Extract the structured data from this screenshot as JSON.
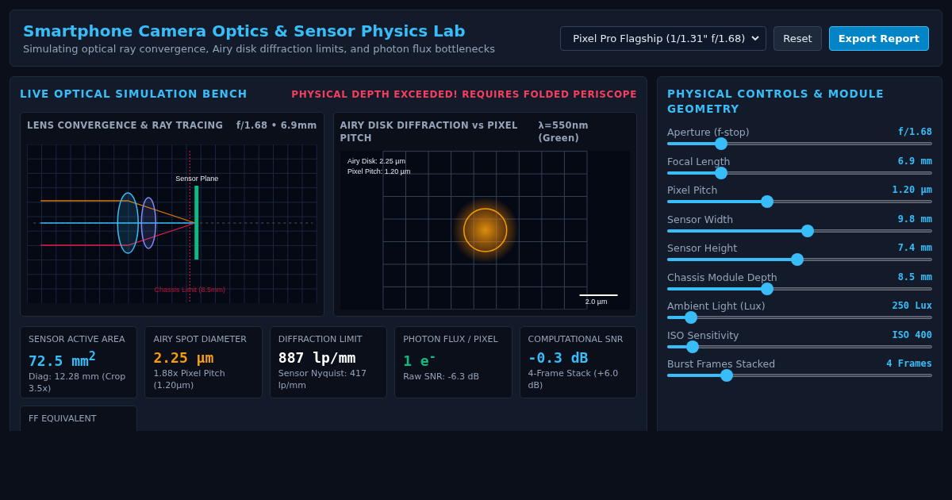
{
  "header": {
    "title": "Smartphone Camera Optics & Sensor Physics Lab",
    "subtitle": "Simulating optical ray convergence, Airy disk diffraction limits, and photon flux bottlenecks",
    "preset": "Pixel Pro Flagship (1/1.31\" f/1.68)",
    "buttons": [
      {
        "label": "Reset",
        "kind": "secondary"
      },
      {
        "label": "Export Report",
        "kind": "primary"
      }
    ]
  },
  "bench": {
    "title": "LIVE OPTICAL SIMULATION BENCH",
    "warning": "PHYSICAL DEPTH EXCEEDED! REQUIRES FOLDED PERISCOPE",
    "lens_panel": {
      "title": "LENS CONVERGENCE & RAY TRACING",
      "reading": "f/1.68 • 6.9mm",
      "sensor_label": "Sensor Plane",
      "chassis_label": "Chassis Limit (8.5mm)"
    },
    "airy_panel": {
      "title": "AIRY DISK DIFFRACTION vs PIXEL PITCH",
      "reading": "λ=550nm (Green)",
      "airy_label": "Airy Disk: 2.25 µm",
      "pitch_label": "Pixel Pitch: 1.20 µm",
      "scale_label": "2.0 µm"
    },
    "metrics": [
      {
        "label": "SENSOR ACTIVE AREA",
        "value": "72.5 mm$^{2}$",
        "note": "Diag: 12.28 mm (Crop 3.5x)",
        "color": "#38bdf8"
      },
      {
        "label": "AIRY SPOT DIAMETER",
        "value": "2.25 µm",
        "note": "1.88x Pixel Pitch (1.20µm)",
        "color": "#f59e0b"
      },
      {
        "label": "DIFFRACTION LIMIT",
        "value": "887 lp/mm",
        "note": "Sensor Nyquist: 417 lp/mm",
        "color": "#ffffff"
      },
      {
        "label": "PHOTON FLUX / PIXEL",
        "value": "1 e$^{-}$",
        "note": "Raw SNR: -6.3 dB",
        "color": "#10b981"
      },
      {
        "label": "COMPUTATIONAL SNR",
        "value": "-0.3 dB",
        "note": "4-Frame Stack (+6.0 dB)",
        "color": "#38bdf8"
      },
      {
        "label": "FF EQUIVALENT"
      }
    ]
  },
  "controls": {
    "title": "PHYSICAL CONTROLS & MODULE GEOMETRY",
    "sliders": [
      {
        "label": "Aperture (f-stop)",
        "value": "f/1.68",
        "level": 0.19
      },
      {
        "label": "Focal Length",
        "value": "6.9 mm",
        "level": 0.19
      },
      {
        "label": "Pixel Pitch",
        "value": "1.20 µm",
        "level": 0.37
      },
      {
        "label": "Sensor Width",
        "value": "9.8 mm",
        "level": 0.53
      },
      {
        "label": "Sensor Height",
        "value": "7.4 mm",
        "level": 0.49
      },
      {
        "label": "Chassis Module Depth",
        "value": "8.5 mm",
        "level": 0.37
      },
      {
        "label": "Ambient Light (Lux)",
        "value": "250 Lux",
        "level": 0.07
      },
      {
        "label": "ISO Sensitivity",
        "value": "ISO 400",
        "level": 0.075
      },
      {
        "label": "Burst Frames Stacked",
        "value": "4 Frames",
        "level": 0.21
      }
    ]
  }
}
